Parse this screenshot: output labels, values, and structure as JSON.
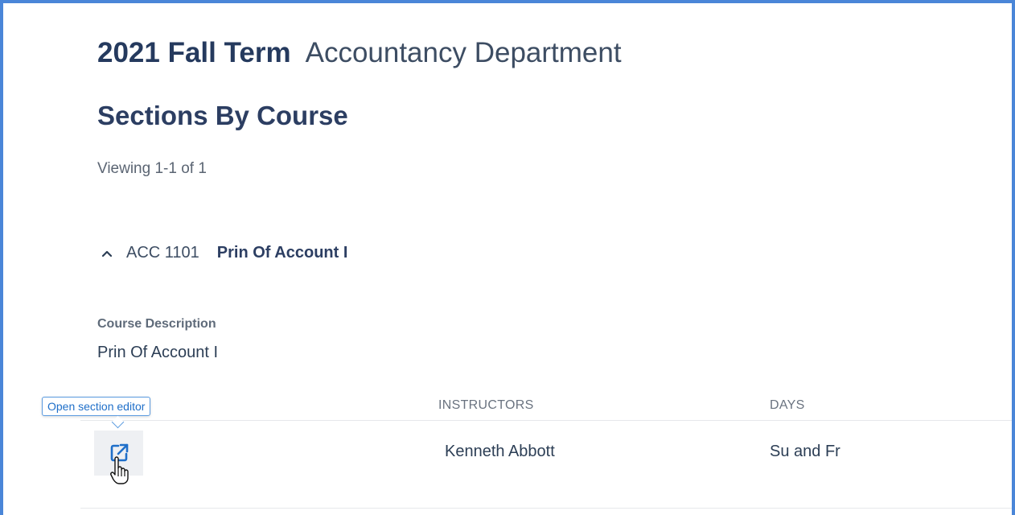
{
  "header": {
    "term": "2021 Fall Term",
    "department": "Accountancy Department"
  },
  "page": {
    "title": "Sections By Course",
    "viewing": "Viewing 1-1 of 1"
  },
  "course": {
    "code": "ACC 1101",
    "name": "Prin Of Account I",
    "expanded": true,
    "description_label": "Course Description",
    "description": "Prin Of Account I"
  },
  "table": {
    "columns": [
      "INSTRUCTORS",
      "DAYS"
    ],
    "rows": [
      {
        "instructors": "Kenneth Abbott",
        "days": "Su and Fr"
      }
    ]
  },
  "tooltip": {
    "text": "Open section editor"
  },
  "icons": {
    "expand": "chevron-up-icon",
    "edit": "open-external-icon",
    "cursor": "hand-pointer-icon"
  },
  "colors": {
    "frame": "#4a86d8",
    "accent": "#1f6fc9",
    "heading": "#253a5e"
  }
}
